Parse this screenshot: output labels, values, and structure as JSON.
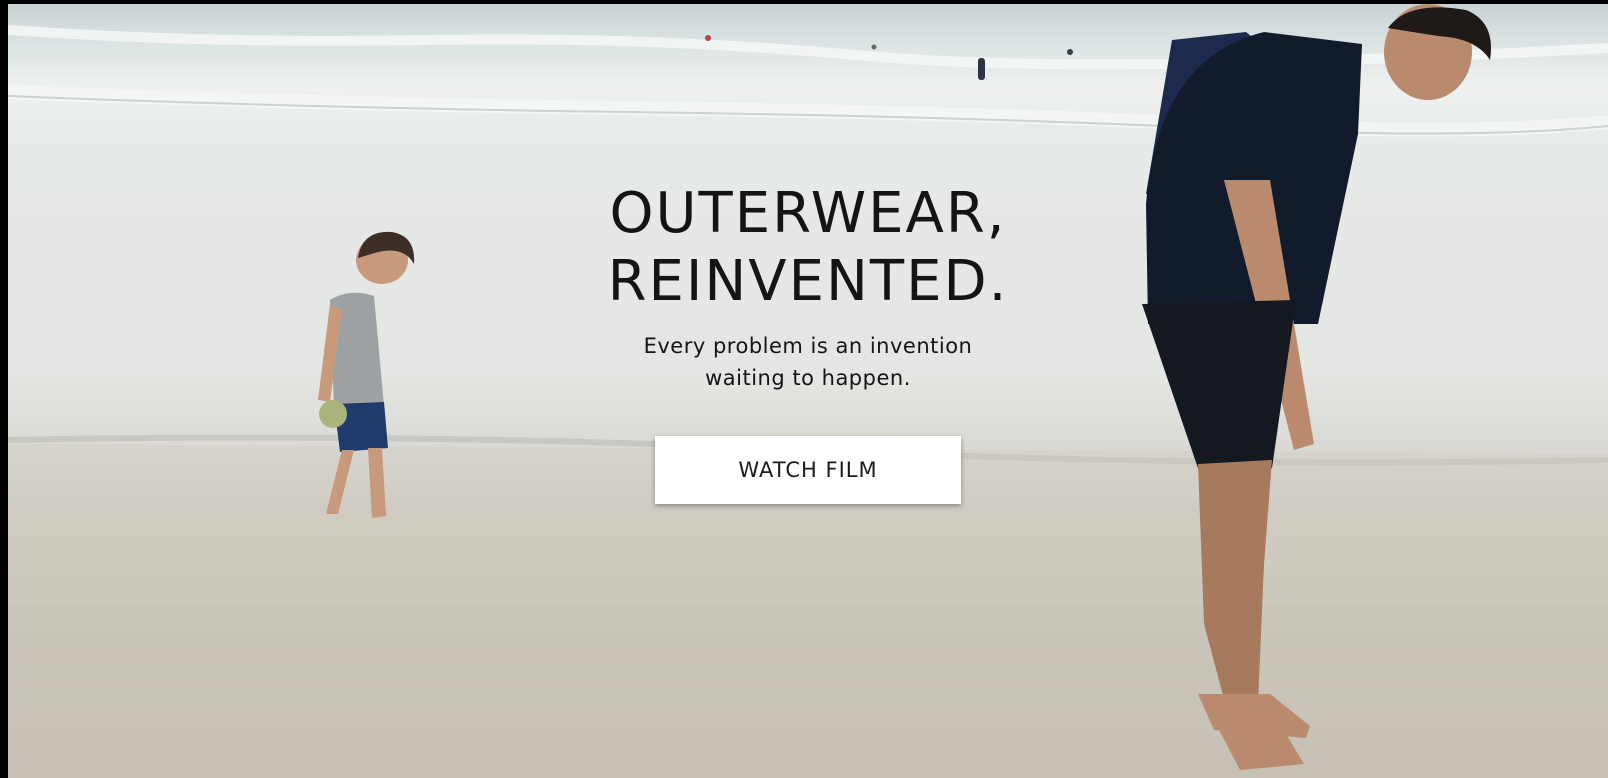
{
  "hero": {
    "headline_line1": "OUTERWEAR,",
    "headline_line2": "REINVENTED.",
    "subhead_line1": "Every problem is an invention",
    "subhead_line2": "waiting to happen.",
    "cta_label": "WATCH FILM"
  },
  "colors": {
    "page_background": "#000000",
    "sky_sea": "#dfe6e6",
    "sand": "#c9c3b8",
    "text": "#141414",
    "button_background": "#ffffff"
  },
  "icons": [
    "play-film-button"
  ]
}
